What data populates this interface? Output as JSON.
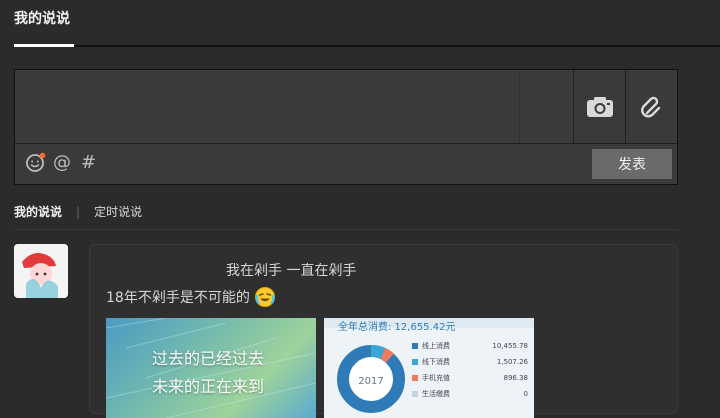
{
  "page": {
    "title": "我的说说"
  },
  "composer": {
    "placeholder": "",
    "camera_icon": "camera-icon",
    "attach_icon": "paperclip-icon",
    "tools": {
      "emoji_icon": "emoji-icon",
      "at_label": "@",
      "hash_label": "#"
    },
    "publish_label": "发表"
  },
  "subtabs": [
    {
      "label": "我的说说"
    },
    {
      "label": "定时说说"
    }
  ],
  "post": {
    "avatar_icon": "avatar",
    "line1": "我在剁手 一直在剁手",
    "line2": "18年不剁手是不可能的",
    "emoji_icon": "crying-laughing-emoji-icon",
    "images": [
      {
        "line1": "过去的已经过去",
        "line2": "未来的正在来到"
      },
      {
        "total_text": "全年总消费: 12,655.42元",
        "donut_label": "2017",
        "legend": [
          {
            "label": "线上消费",
            "value": "10,455.78",
            "color": "#2e7bb7"
          },
          {
            "label": "线下消费",
            "value": "1,507.26",
            "color": "#3aa6d8"
          },
          {
            "label": "手机充值",
            "value": "896.38",
            "color": "#f07c5c"
          },
          {
            "label": "生活缴费",
            "value": "0",
            "color": "#c7d3dc"
          }
        ]
      }
    ]
  },
  "colors": {
    "background": "#2b2b2b",
    "composer_bg": "#3a3a3a",
    "publish_bg": "#6a6a6a",
    "text": "#e6e6e6"
  }
}
